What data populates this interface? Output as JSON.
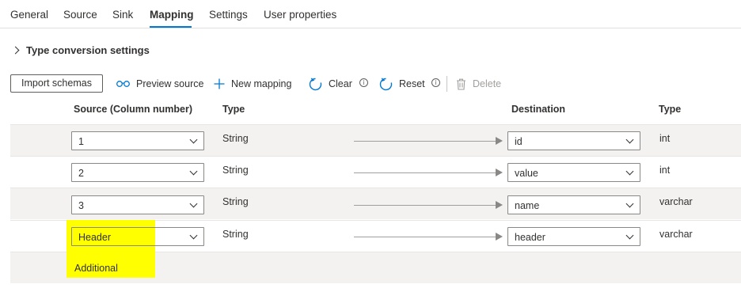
{
  "tabs": [
    {
      "label": "General",
      "active": false
    },
    {
      "label": "Source",
      "active": false
    },
    {
      "label": "Sink",
      "active": false
    },
    {
      "label": "Mapping",
      "active": true
    },
    {
      "label": "Settings",
      "active": false
    },
    {
      "label": "User properties",
      "active": false
    }
  ],
  "type_conversion": {
    "label": "Type conversion settings"
  },
  "toolbar": {
    "import_schemas": "Import schemas",
    "preview_source": "Preview source",
    "new_mapping": "New mapping",
    "clear": "Clear",
    "reset": "Reset",
    "delete": "Delete"
  },
  "columns": {
    "source": "Source (Column number)",
    "source_type": "Type",
    "destination": "Destination",
    "destination_type": "Type"
  },
  "rows": [
    {
      "source": "1",
      "source_type": "String",
      "destination": "id",
      "destination_type": "int"
    },
    {
      "source": "2",
      "source_type": "String",
      "destination": "value",
      "destination_type": "int"
    },
    {
      "source": "3",
      "source_type": "String",
      "destination": "name",
      "destination_type": "varchar"
    },
    {
      "source": "Header",
      "source_type": "String",
      "destination": "header",
      "destination_type": "varchar"
    }
  ],
  "additional": "Additional",
  "colors": {
    "accent": "#0078d4",
    "highlight": "#ffff00",
    "row_bg": "#f3f2f1"
  },
  "icons": [
    "chevron-right-icon",
    "preview-glasses-icon",
    "plus-icon",
    "refresh-icon",
    "info-icon",
    "reset-icon",
    "trash-icon",
    "chevron-down-icon"
  ]
}
